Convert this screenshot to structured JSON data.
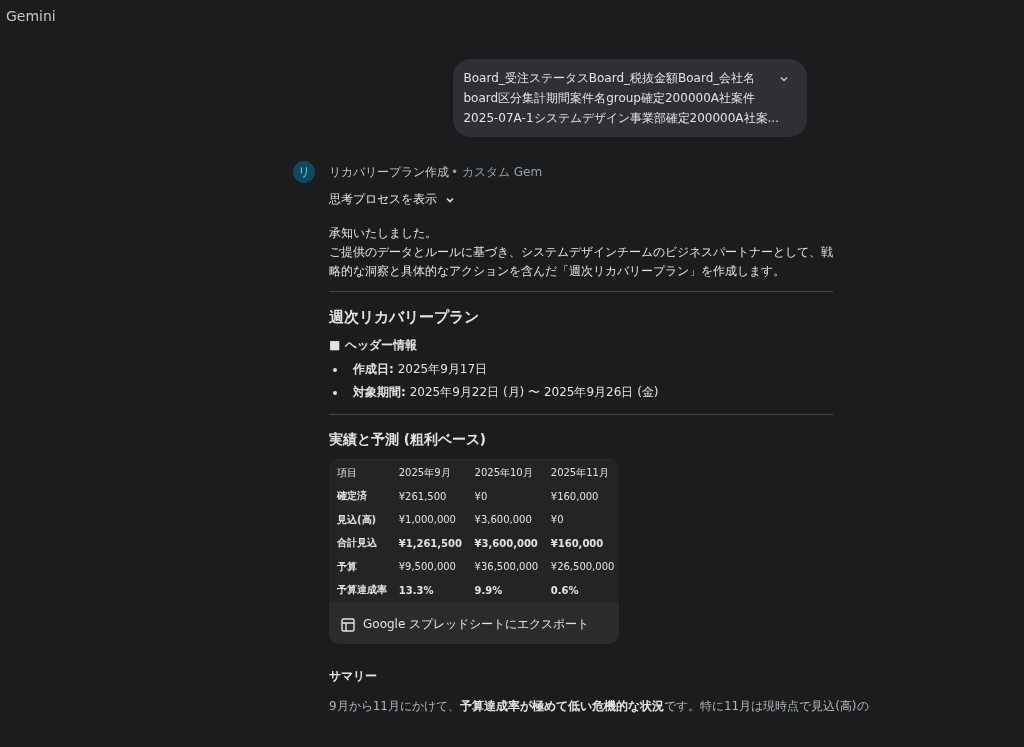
{
  "app_title": "Gemini",
  "user_message": {
    "lines": [
      "Board_受注ステータスBoard_税抜金額Board_会社名",
      "board区分集計期間案件名group確定200000A社案件",
      "2025-07A-1システムデザイン事業部確定200000A社案..."
    ],
    "expanded": false
  },
  "response": {
    "avatar": "リ",
    "gem_name": "リカバリープラン作成",
    "gem_suffix": "• カスタム Gem",
    "thinking_toggle": "思考プロセスを表示",
    "intro": [
      "承知いたしました。",
      "ご提供のデータとルールに基づき、システムデザインチームのビジネスパートナーとして、戦略的な洞察と具体的なアクションを含んだ「週次リカバリープラン」を作成します。"
    ],
    "title": "週次リカバリープラン",
    "header_section": "■ ヘッダー情報",
    "header_items": [
      {
        "label": "作成日:",
        "value": "2025年9月17日"
      },
      {
        "label": "対象期間:",
        "value": "2025年9月22日 (月) 〜 2025年9月26日 (金)"
      }
    ],
    "forecast_title": "実績と予測 (粗利ベース)",
    "table": {
      "columns": [
        "項目",
        "2025年9月",
        "2025年10月",
        "2025年11月"
      ],
      "rows": [
        {
          "cells": [
            "確定済",
            "¥261,500",
            "¥0",
            "¥160,000"
          ],
          "bold": false
        },
        {
          "cells": [
            "見込(高)",
            "¥1,000,000",
            "¥3,600,000",
            "¥0"
          ],
          "bold": false
        },
        {
          "cells": [
            "合計見込",
            "¥1,261,500",
            "¥3,600,000",
            "¥160,000"
          ],
          "bold": true
        },
        {
          "cells": [
            "予算",
            "¥9,500,000",
            "¥36,500,000",
            "¥26,500,000"
          ],
          "bold": false
        },
        {
          "cells": [
            "予算達成率",
            "13.3%",
            "9.9%",
            "0.6%"
          ],
          "bold": true
        }
      ]
    },
    "export_button": "Google スプレッドシートにエクスポート",
    "summary_title": "サマリー",
    "summary_text": "9月から11月にかけて、**予算達成率が極めて低い危機的な状況**です。特に11月は現時点で見込(高)の"
  }
}
